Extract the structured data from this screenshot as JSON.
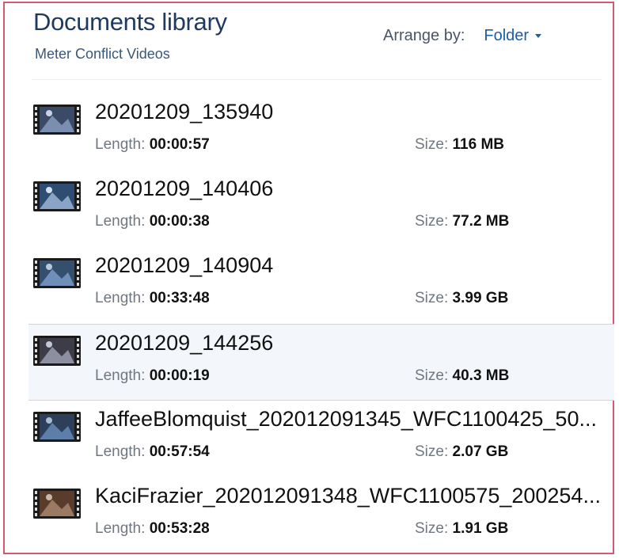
{
  "header": {
    "title": "Documents library",
    "subtitle": "Meter Conflict Videos",
    "arrange_label": "Arrange by:",
    "arrange_value": "Folder"
  },
  "labels": {
    "length": "Length:",
    "size": "Size:"
  },
  "files": [
    {
      "name": "20201209_135940",
      "length": "00:00:57",
      "size": "116 MB",
      "selected": false,
      "icon": "video-file-icon"
    },
    {
      "name": "20201209_140406",
      "length": "00:00:38",
      "size": "77.2 MB",
      "selected": false,
      "icon": "video-file-icon"
    },
    {
      "name": "20201209_140904",
      "length": "00:33:48",
      "size": "3.99 GB",
      "selected": false,
      "icon": "video-file-icon"
    },
    {
      "name": "20201209_144256",
      "length": "00:00:19",
      "size": "40.3 MB",
      "selected": true,
      "icon": "video-file-icon"
    },
    {
      "name": "JaffeeBlomquist_202012091345_WFC1100425_50...",
      "length": "00:57:54",
      "size": "2.07 GB",
      "selected": false,
      "icon": "video-file-icon"
    },
    {
      "name": "KaciFrazier_202012091348_WFC1100575_200254...",
      "length": "00:53:28",
      "size": "1.91 GB",
      "selected": false,
      "icon": "video-file-icon"
    }
  ],
  "colors": {
    "border": "#d45a72",
    "title": "#1e3a5f",
    "accent": "#1c5ea8",
    "selected_bg": "#f3f7fb"
  }
}
